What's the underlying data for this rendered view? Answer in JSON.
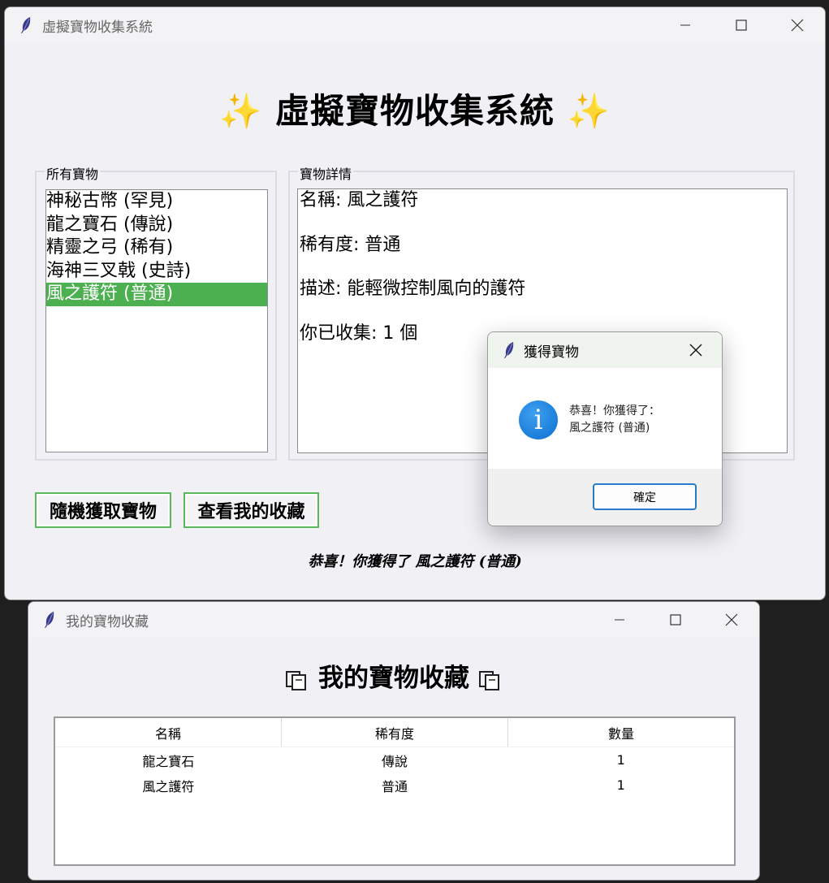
{
  "main_window": {
    "title": "虛擬寶物收集系統",
    "heading": "✨ 虛擬寶物收集系統 ✨",
    "list_frame_label": "所有寶物",
    "items": [
      "神秘古幣 (罕見)",
      "龍之寶石 (傳說)",
      "精靈之弓 (稀有)",
      "海神三叉戟 (史詩)",
      "風之護符 (普通)"
    ],
    "selected_index": 4,
    "detail_frame_label": "寶物詳情",
    "details": [
      "名稱: 風之護符",
      "稀有度: 普通",
      "描述: 能輕微控制風向的護符",
      "你已收集: 1 個"
    ],
    "buttons": {
      "random": "隨機獲取寶物",
      "view": "查看我的收藏"
    },
    "status": "恭喜！你獲得了 風之護符 (普通)"
  },
  "dialog": {
    "title": "獲得寶物",
    "message_line1": "恭喜！你獲得了：",
    "message_line2": "風之護符 (普通)",
    "ok_label": "確定"
  },
  "collection_window": {
    "title": "我的寶物收藏",
    "heading": "我的寶物收藏",
    "columns": [
      "名稱",
      "稀有度",
      "數量"
    ],
    "rows": [
      [
        "龍之寶石",
        "傳說",
        "1"
      ],
      [
        "風之護符",
        "普通",
        "1"
      ]
    ]
  },
  "colors": {
    "selection": "#4caf50",
    "button_border": "#5cb85c",
    "info_blue": "#0b6fd0"
  }
}
